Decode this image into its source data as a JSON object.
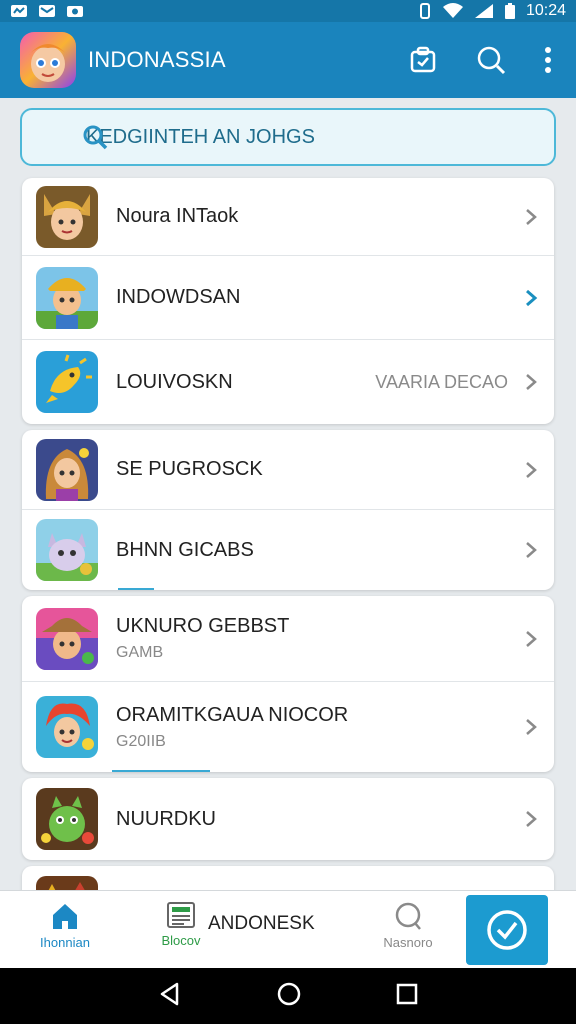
{
  "status_bar": {
    "time": "10:24"
  },
  "app_bar": {
    "title": "INDONASSIA",
    "actions": [
      "clipboard-icon",
      "search-icon",
      "more-vert-icon"
    ]
  },
  "search": {
    "text": "KEDGIINTEH AN JOHGS"
  },
  "cards": [
    {
      "rows": [
        {
          "title": "Noura INTaok",
          "subtitle": "",
          "value": "",
          "icon": "fox-character-icon"
        },
        {
          "title": "INDOWDSAN",
          "subtitle": "",
          "value": "",
          "icon": "boy-hat-character-icon"
        },
        {
          "title": "LOUIVOSKN",
          "subtitle": "",
          "value": "VAARIA DECAO",
          "icon": "sun-fish-icon"
        }
      ]
    },
    {
      "rows": [
        {
          "title": "SE PUGROSCK",
          "subtitle": "",
          "value": "",
          "icon": "girl-character-icon"
        },
        {
          "title": "BHNN GICABS",
          "subtitle": "",
          "value": "",
          "icon": "cat-character-icon"
        }
      ]
    },
    {
      "rows": [
        {
          "title": "UKNURO GEBBST",
          "subtitle": "GAMB",
          "value": "",
          "icon": "cowboy-character-icon"
        },
        {
          "title": "ORAMITKGAUA NIOCOR",
          "subtitle": "G20IIB",
          "value": "",
          "icon": "redhead-character-icon"
        }
      ]
    },
    {
      "rows": [
        {
          "title": "NUURDKU",
          "subtitle": "",
          "value": "",
          "icon": "dino-character-icon"
        }
      ]
    }
  ],
  "bottom_nav": {
    "items": [
      {
        "label": "Ihonnian",
        "icon": "home-icon",
        "color": "#1c88c4"
      },
      {
        "label": "Blocov",
        "icon": "newspaper-icon",
        "color": "#2e9b47"
      },
      {
        "label": "ANDONESK",
        "icon": "",
        "color": "#222222"
      },
      {
        "label": "Nasnoro",
        "icon": "chat-bubble-icon",
        "color": "#888888"
      }
    ],
    "fab_icon": "check-circle-icon"
  },
  "colors": {
    "primary": "#1a84bd",
    "accent": "#1c9bd0",
    "search_border": "#4db8d8"
  }
}
